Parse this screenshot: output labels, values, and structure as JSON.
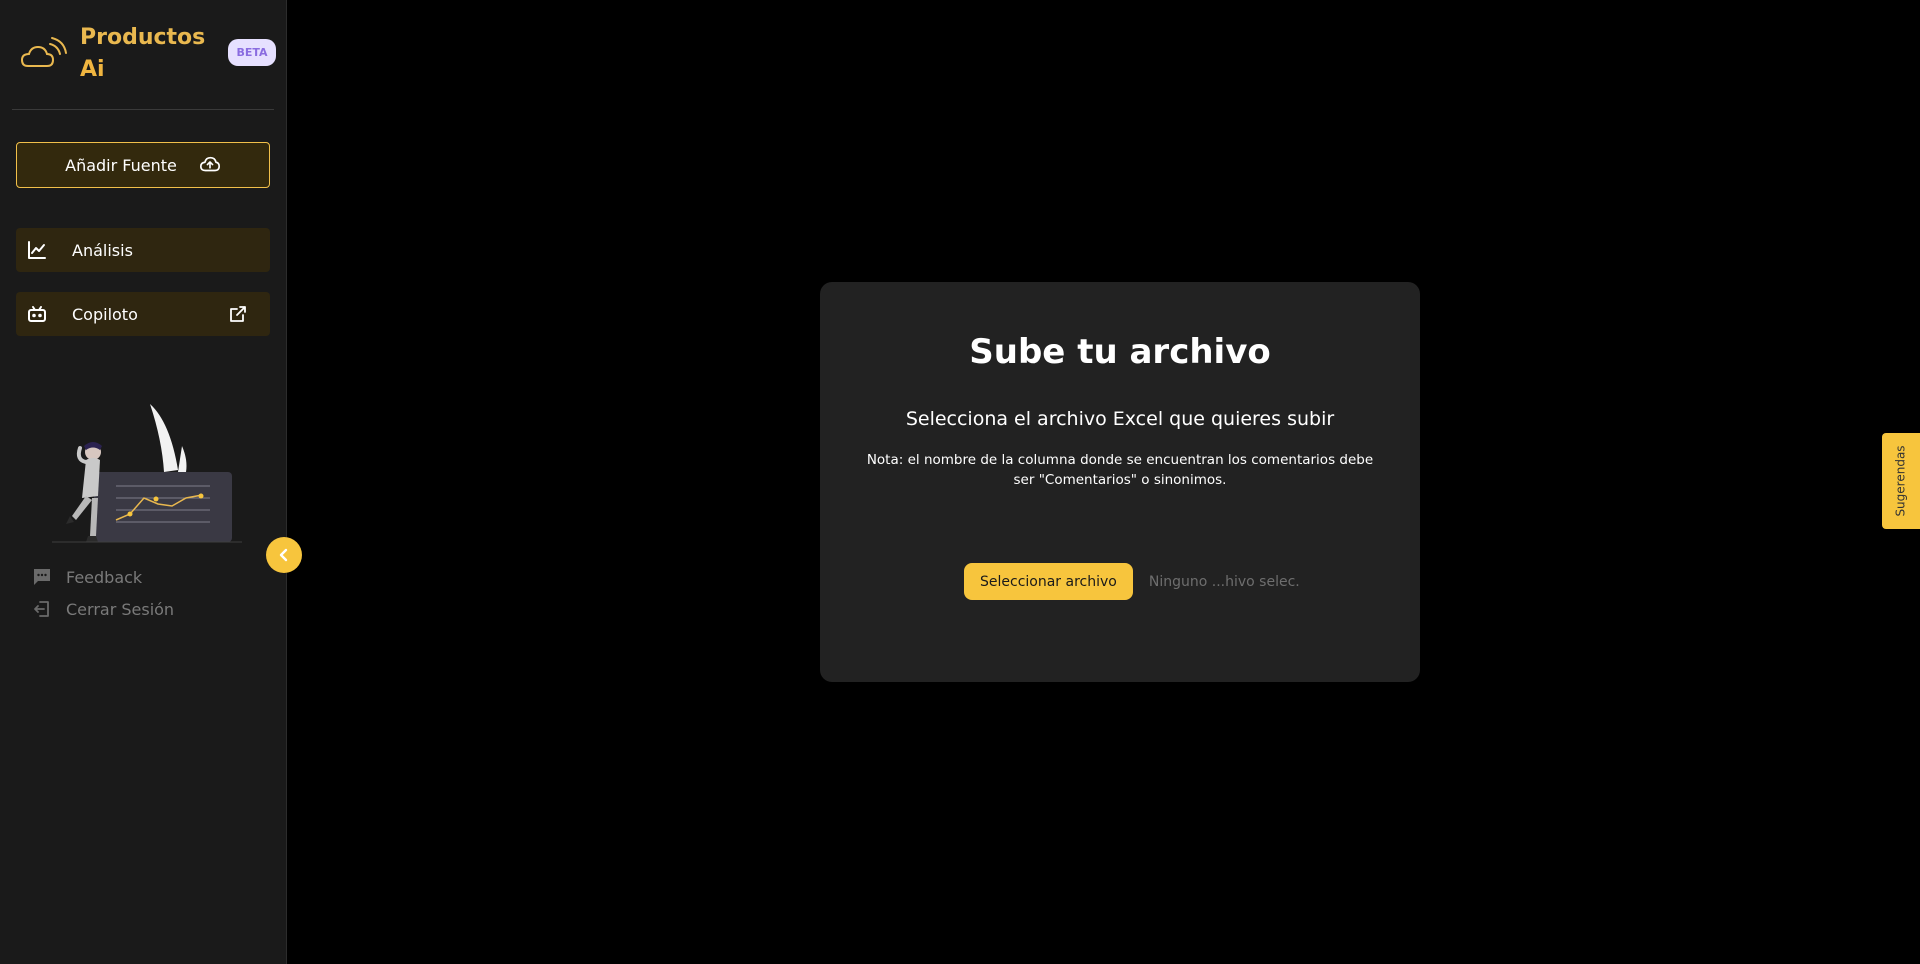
{
  "brand": {
    "title_line1": "Productos",
    "title_line2": "Ai",
    "badge": "BETA"
  },
  "sidebar": {
    "add_source_label": "Añadir Fuente",
    "nav": [
      {
        "label": "Análisis",
        "icon": "line-chart-icon"
      },
      {
        "label": "Copiloto",
        "icon": "bot-icon",
        "trailing_icon": "external-link-icon"
      }
    ],
    "footer": [
      {
        "label": "Feedback",
        "icon": "chat-icon"
      },
      {
        "label": "Cerrar Sesión",
        "icon": "logout-icon"
      }
    ],
    "collapse_icon": "chevron-left-icon"
  },
  "upload": {
    "title": "Sube tu archivo",
    "subtitle": "Selecciona el archivo Excel que quieres subir",
    "note": "Nota: el nombre de la columna donde se encuentran los comentarios debe ser \"Comentarios\" o sinonimos.",
    "button_label": "Seleccionar archivo",
    "file_status": "Ninguno ...hivo selec."
  },
  "suggestions_tab": {
    "label": "Sugerendas"
  },
  "colors": {
    "accent": "#f7c53d",
    "card": "#222222",
    "sidebar": "#1a1a1a",
    "background": "#000000"
  }
}
